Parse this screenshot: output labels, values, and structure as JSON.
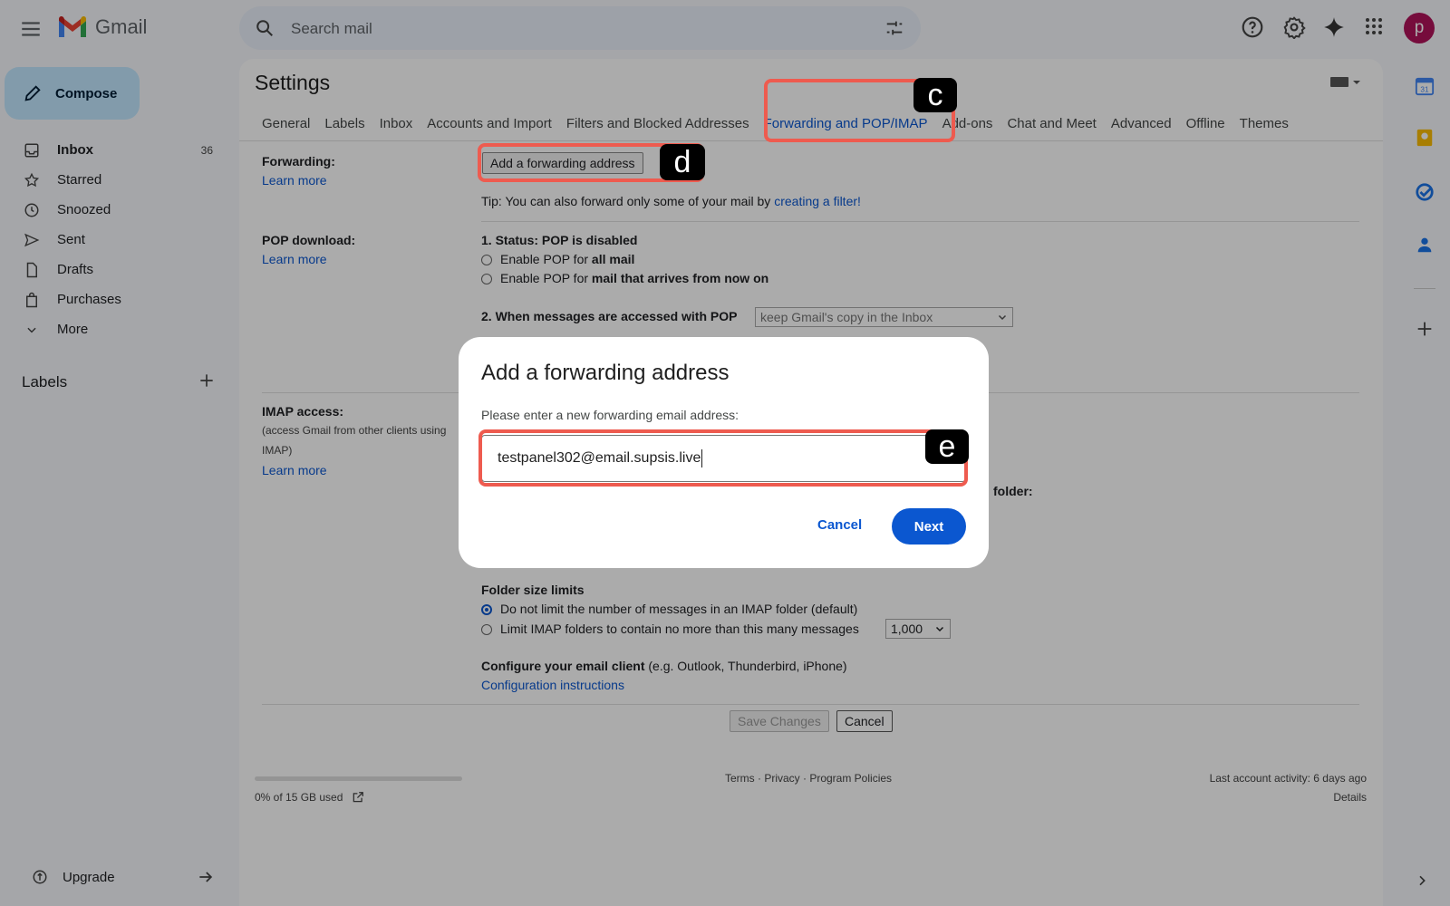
{
  "app": {
    "title": "Gmail",
    "avatar_letter": "p"
  },
  "search": {
    "placeholder": "Search mail"
  },
  "sidebar": {
    "compose_label": "Compose",
    "items": [
      {
        "label": "Inbox",
        "count": "36",
        "icon": "inbox-icon"
      },
      {
        "label": "Starred",
        "count": "",
        "icon": "star-icon"
      },
      {
        "label": "Snoozed",
        "count": "",
        "icon": "clock-icon"
      },
      {
        "label": "Sent",
        "count": "",
        "icon": "send-icon"
      },
      {
        "label": "Drafts",
        "count": "",
        "icon": "file-icon"
      },
      {
        "label": "Purchases",
        "count": "",
        "icon": "bag-icon"
      },
      {
        "label": "More",
        "count": "",
        "icon": "chevron-down-icon"
      }
    ],
    "labels_header": "Labels",
    "upgrade_label": "Upgrade"
  },
  "settings": {
    "title": "Settings",
    "tabs": [
      "General",
      "Labels",
      "Inbox",
      "Accounts and Import",
      "Filters and Blocked Addresses",
      "Forwarding and POP/IMAP",
      "Add-ons",
      "Chat and Meet",
      "Advanced",
      "Offline",
      "Themes"
    ],
    "active_tab": "Forwarding and POP/IMAP",
    "forwarding": {
      "label": "Forwarding:",
      "learn_more": "Learn more",
      "add_button": "Add a forwarding address",
      "tip_prefix": "Tip: You can also forward only some of your mail by",
      "tip_link": "creating a filter!"
    },
    "pop": {
      "label": "POP download:",
      "learn_more": "Learn more",
      "status": "1. Status: POP is disabled",
      "opt1_prefix": "Enable POP for",
      "opt1_bold": "all mail",
      "opt2_prefix": "Enable POP for",
      "opt2_bold": "mail that arrives from now on",
      "when_label": "2. When messages are accessed with POP",
      "when_value": "keep Gmail's copy in the Inbox"
    },
    "imap": {
      "label": "IMAP access:",
      "sub1": "(access Gmail from other clients using",
      "sub2": "IMAP)",
      "learn_more": "Learn more",
      "folder_fragment": "folder:",
      "folder_size_title": "Folder size limits",
      "opt_no_limit": "Do not limit the number of messages in an IMAP folder (default)",
      "opt_limit": "Limit IMAP folders to contain no more than this many messages",
      "limit_value": "1,000",
      "client_bold": "Configure your email client",
      "client_rest": "(e.g. Outlook, Thunderbird, iPhone)",
      "config_link": "Configuration instructions"
    },
    "save_changes": "Save Changes",
    "cancel": "Cancel"
  },
  "footer": {
    "storage": "0% of 15 GB used",
    "storage_fraction": 0.0,
    "links": "Terms · Privacy · Program Policies",
    "last_activity": "Last account activity: 6 days ago",
    "details": "Details"
  },
  "dialog": {
    "title": "Add a forwarding address",
    "prompt": "Please enter a new forwarding email address:",
    "input_value": "testpanel302@email.supsis.live",
    "cancel": "Cancel",
    "next": "Next"
  },
  "annotations": {
    "c": "c",
    "d": "d",
    "e": "e"
  },
  "colors": {
    "accent": "#0b57d0",
    "highlight": "#ee5b4f",
    "avatar": "#b0135a"
  }
}
